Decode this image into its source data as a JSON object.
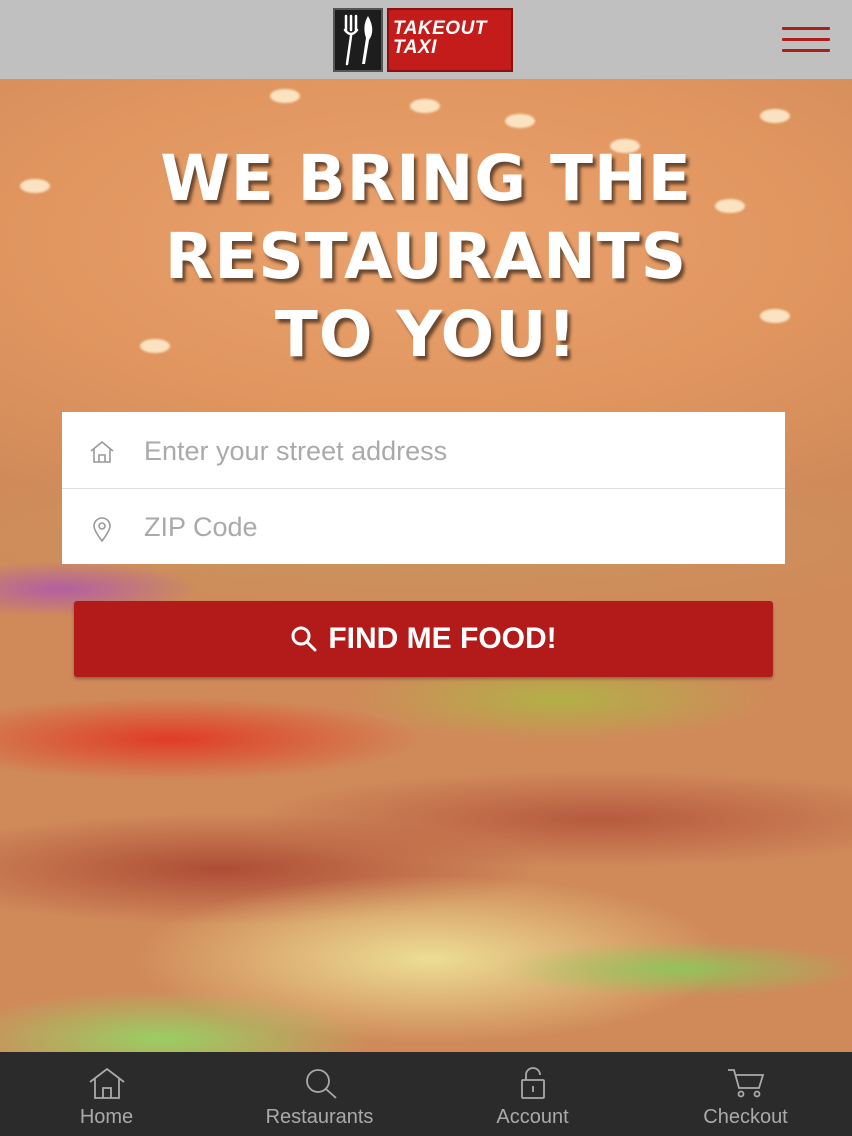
{
  "header": {
    "logo_text_line1": "TAKEOUT",
    "logo_text_line2": "TAXI",
    "menu_icon": "hamburger-icon",
    "brand_color": "#c41b1b"
  },
  "hero": {
    "headline": [
      "WE BRING THE",
      "RESTAURANTS",
      "TO YOU!"
    ]
  },
  "form": {
    "address_placeholder": "Enter your street address",
    "address_icon": "home-icon",
    "zip_placeholder": "ZIP Code",
    "zip_icon": "location-pin-icon",
    "submit_label": "FIND ME FOOD!",
    "submit_icon": "search-icon",
    "submit_color": "#b31b1b"
  },
  "tabs": [
    {
      "label": "Home",
      "icon": "home-icon"
    },
    {
      "label": "Restaurants",
      "icon": "search-icon"
    },
    {
      "label": "Account",
      "icon": "lock-icon"
    },
    {
      "label": "Checkout",
      "icon": "cart-icon"
    }
  ]
}
